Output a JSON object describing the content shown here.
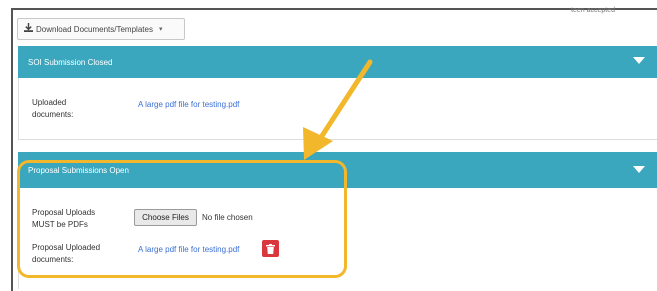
{
  "page": {
    "corner_note": "teen accepted"
  },
  "toolbar": {
    "download_label": "Download Documents/Templates",
    "download_icon": "download-icon",
    "caret_glyph": "▾"
  },
  "soi_panel": {
    "title": "SOI Submission Closed",
    "uploaded_label_line1": "Uploaded",
    "uploaded_label_line2": "documents:",
    "file_link": "A large pdf file for testing.pdf"
  },
  "proposal_panel": {
    "title": "Proposal Submissions Open",
    "upload_label_line1": "Proposal Uploads",
    "upload_label_line2": "MUST be PDFs",
    "choose_button": "Choose Files",
    "no_file_text": "No file chosen",
    "uploaded_label_line1": "Proposal Uploaded",
    "uploaded_label_line2": "documents:",
    "file_link": "A large pdf file for testing.pdf"
  },
  "colors": {
    "panel_header": "#3aa7bf",
    "highlight": "#f2b72a",
    "link": "#3b6fd6",
    "delete_button": "#d9363e"
  }
}
